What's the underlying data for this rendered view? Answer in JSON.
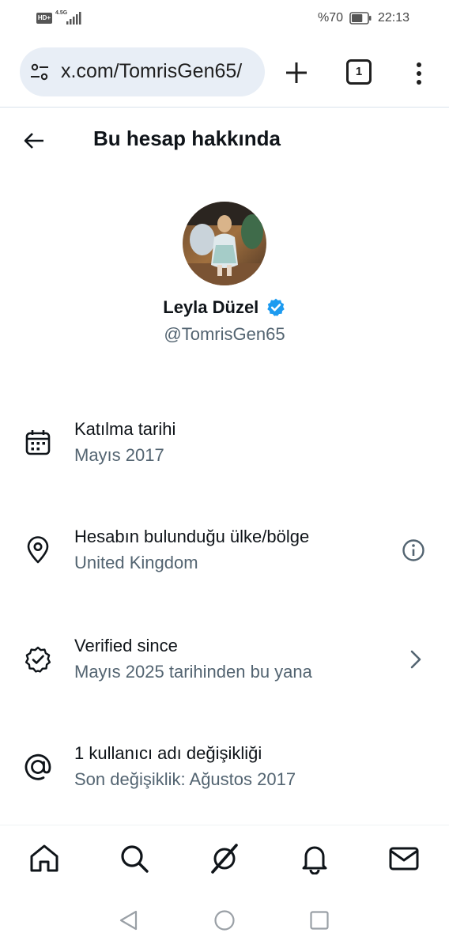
{
  "status_bar": {
    "hd_label": "HD+",
    "network_label": "4.5G",
    "battery_percent": "%70",
    "battery_level": 0.7,
    "time": "22:13"
  },
  "browser": {
    "url": "x.com/TomrisGen65/",
    "tab_count": "1",
    "icons": [
      "tune-icon",
      "plus-icon",
      "tabs-icon",
      "more-vert-icon"
    ]
  },
  "header": {
    "title": "Bu hesap hakkında"
  },
  "profile": {
    "display_name": "Leyla Düzel",
    "handle": "@TomrisGen65",
    "verified": true
  },
  "info_rows": [
    {
      "icon": "calendar-icon",
      "title": "Katılma tarihi",
      "subtitle": "Mayıs 2017"
    },
    {
      "icon": "location-pin-icon",
      "title": "Hesabın bulunduğu ülke/bölge",
      "subtitle": "United Kingdom",
      "trailing": "info-icon"
    },
    {
      "icon": "verified-outline-icon",
      "title": "Verified since",
      "subtitle": "Mayıs 2025 tarihinden bu yana",
      "trailing": "chevron-right-icon"
    },
    {
      "icon": "at-sign-icon",
      "title": "1 kullanıcı adı değişikliği",
      "subtitle": "Son değişiklik: Ağustos 2017"
    }
  ],
  "bottom_nav": [
    "home-icon",
    "search-icon",
    "grok-icon",
    "notifications-icon",
    "messages-icon"
  ],
  "colors": {
    "text_primary": "#0f1419",
    "text_secondary": "#536471",
    "verified_blue": "#1d9bf0",
    "url_bar_bg": "#e8eef6"
  }
}
